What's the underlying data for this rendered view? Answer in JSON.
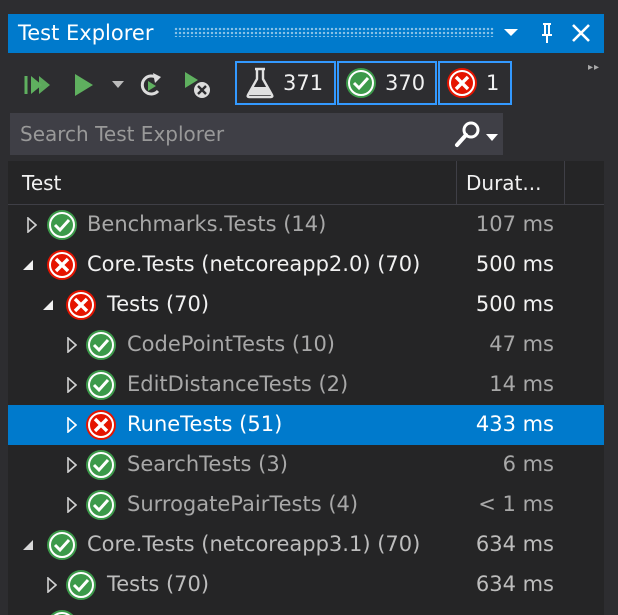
{
  "window": {
    "title": "Test Explorer"
  },
  "toolbar": {
    "counters": {
      "total": "371",
      "passed": "370",
      "failed": "1"
    }
  },
  "search": {
    "placeholder": "Search Test Explorer"
  },
  "columns": {
    "test": "Test",
    "duration": "Durat..."
  },
  "rows": [
    {
      "label": "Benchmarks.Tests",
      "count": "(14)",
      "duration": "107 ms"
    },
    {
      "label": "Core.Tests (netcoreapp2.0)",
      "count": "(70)",
      "duration": "500 ms"
    },
    {
      "label": "Tests",
      "count": "(70)",
      "duration": "500 ms"
    },
    {
      "label": "CodePointTests",
      "count": "(10)",
      "duration": "47 ms"
    },
    {
      "label": "EditDistanceTests",
      "count": "(2)",
      "duration": "14 ms"
    },
    {
      "label": "RuneTests",
      "count": "(51)",
      "duration": "433 ms"
    },
    {
      "label": "SearchTests",
      "count": "(3)",
      "duration": "6 ms"
    },
    {
      "label": "SurrogatePairTests",
      "count": "(4)",
      "duration": "< 1 ms"
    },
    {
      "label": "Core.Tests (netcoreapp3.1)",
      "count": "(70)",
      "duration": "634 ms"
    },
    {
      "label": "Tests",
      "count": "(70)",
      "duration": "634 ms"
    }
  ],
  "colors": {
    "accent": "#007acc",
    "pass": "#3c9a4a",
    "fail": "#e51400"
  }
}
